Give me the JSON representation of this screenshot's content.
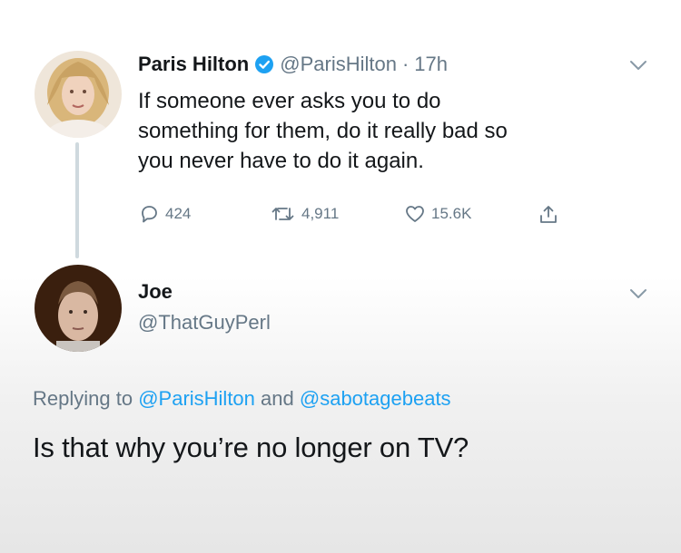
{
  "tweet": {
    "author_name": "Paris Hilton",
    "handle": "@ParisHilton",
    "separator": "·",
    "time": "17h",
    "lines": [
      "If someone ever asks you to do",
      "something for them, do it really bad so",
      "you never have to do it again."
    ],
    "replies": "424",
    "retweets": "4,911",
    "likes": "15.6K",
    "icons": {
      "verified": "verified-badge-icon",
      "more": "chevron-down-icon",
      "reply": "reply-icon",
      "retweet": "retweet-icon",
      "like": "heart-icon",
      "share": "share-icon"
    }
  },
  "reply": {
    "author_name": "Joe",
    "handle": "@ThatGuyPerl",
    "replying_prefix": "Replying to",
    "mention_1": "@ParisHilton",
    "conjunction": "and",
    "mention_2": "@sabotagebeats",
    "text": "Is that why you’re no longer on TV?"
  },
  "colors": {
    "link": "#1da1f2",
    "muted": "#657786",
    "text": "#14171a",
    "verified": "#1da1f2"
  }
}
